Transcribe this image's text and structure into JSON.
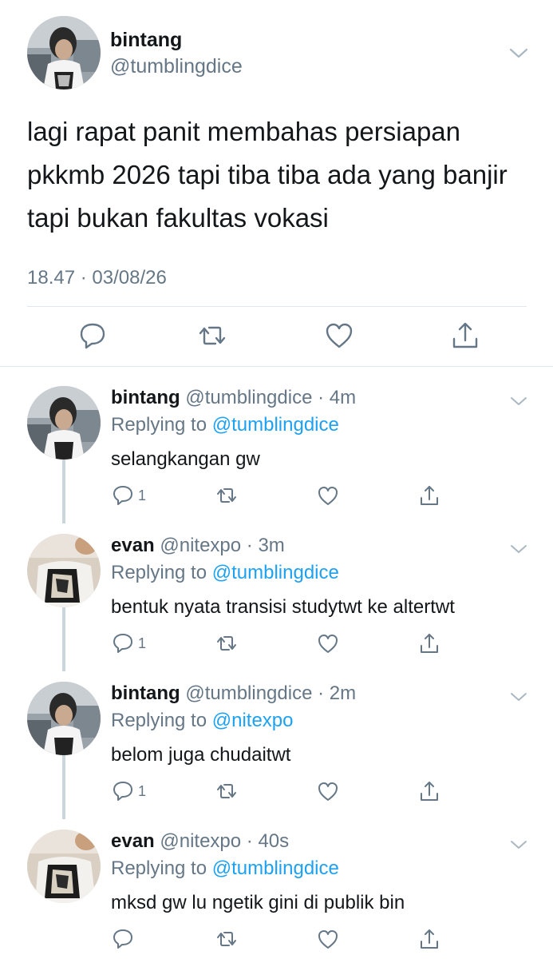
{
  "main_tweet": {
    "name": "bintang",
    "handle": "@tumblingdice",
    "text": "lagi rapat panit membahas persiapan pkkmb 2026 tapi tiba tiba ada yang banjir tapi bukan fakultas vokasi",
    "timestamp": "18.47 · 03/08/26",
    "actions": [
      "reply-icon",
      "retweet-icon",
      "like-icon",
      "share-icon"
    ]
  },
  "replies": [
    {
      "name": "bintang",
      "meta": "@tumblingdice · 4m",
      "replying_prefix": "Replying to",
      "replying_to": "@tumblingdice",
      "text": "selangkangan gw",
      "reply_count": "1"
    },
    {
      "name": "evan",
      "meta": "@nitexpo · 3m",
      "replying_prefix": "Replying to",
      "replying_to": "@tumblingdice",
      "text": "bentuk nyata transisi studytwt ke altertwt",
      "reply_count": "1"
    },
    {
      "name": "bintang",
      "meta": "@tumblingdice · 2m",
      "replying_prefix": "Replying to",
      "replying_to": "@nitexpo",
      "text": "belom juga chudaitwt",
      "reply_count": "1"
    },
    {
      "name": "evan",
      "meta": "@nitexpo · 40s",
      "replying_prefix": "Replying to",
      "replying_to": "@tumblingdice",
      "text": "mksd gw lu ngetik gini di publik bin",
      "reply_count": ""
    }
  ],
  "colors": {
    "text": "#14171a",
    "secondary": "#657786",
    "link": "#1da1f2",
    "divider": "#e1e8ed",
    "thread_line": "#ccd6dd"
  }
}
